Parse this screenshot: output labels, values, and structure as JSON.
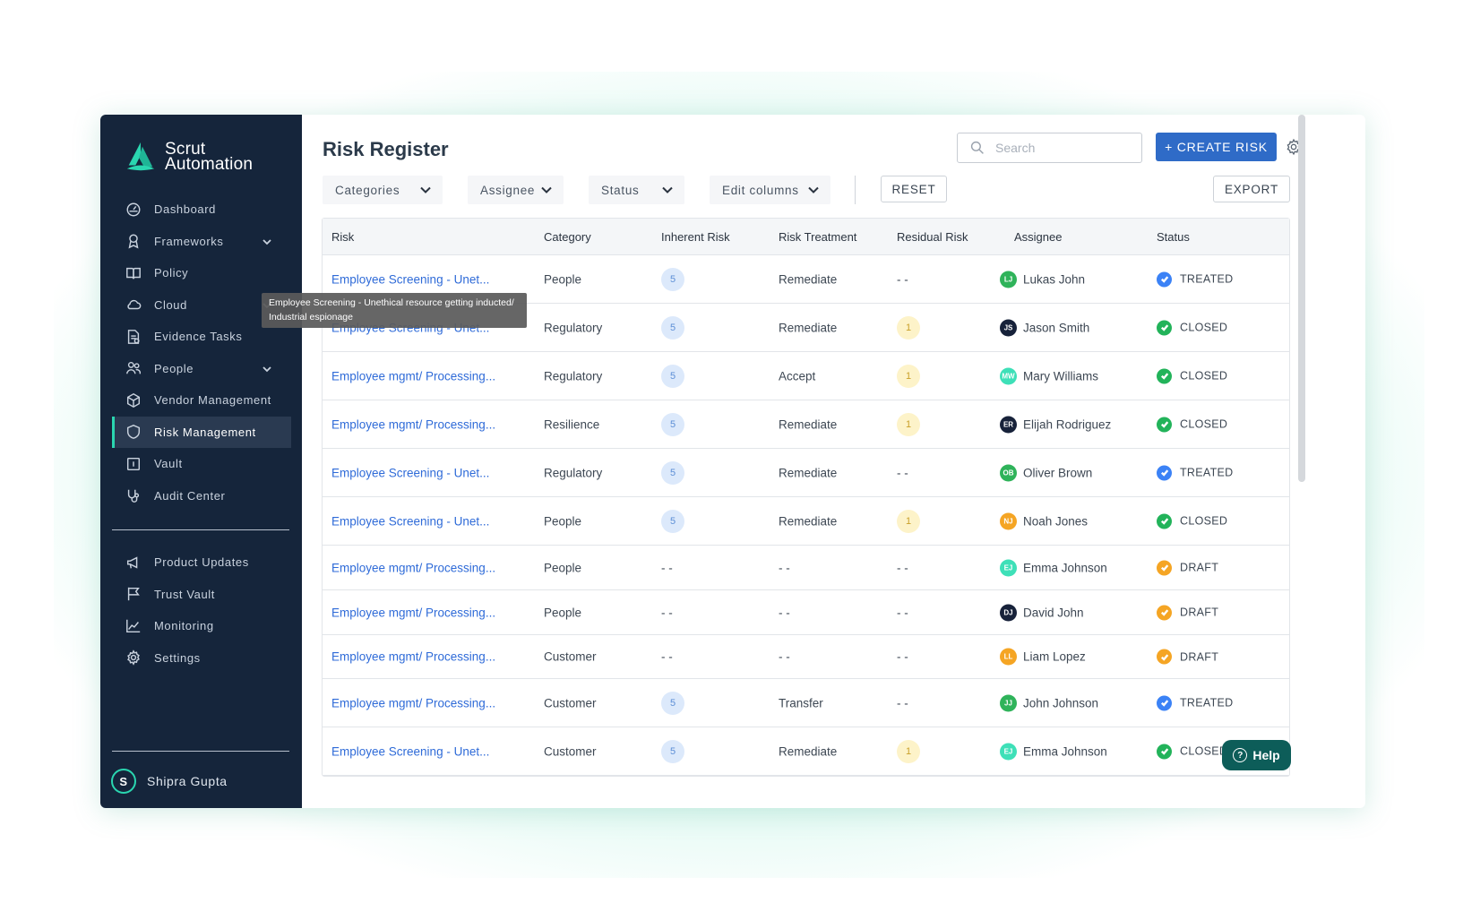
{
  "brand": {
    "line1": "Scrut",
    "line2": "Automation",
    "accent": "#2ad6b0",
    "sidebar_bg": "#15253b"
  },
  "sidebar": {
    "items": [
      {
        "label": "Dashboard",
        "icon": "dashboard-icon",
        "chevron": false
      },
      {
        "label": "Frameworks",
        "icon": "frameworks-icon",
        "chevron": true
      },
      {
        "label": "Policy",
        "icon": "policy-icon",
        "chevron": false
      },
      {
        "label": "Cloud",
        "icon": "cloud-icon",
        "chevron": true
      },
      {
        "label": "Evidence Tasks",
        "icon": "evidence-icon",
        "chevron": false
      },
      {
        "label": "People",
        "icon": "people-icon",
        "chevron": true
      },
      {
        "label": "Vendor Management",
        "icon": "vendor-icon",
        "chevron": false
      },
      {
        "label": "Risk Management",
        "icon": "shield-icon",
        "chevron": false,
        "active": true
      },
      {
        "label": "Vault",
        "icon": "vault-icon",
        "chevron": false
      },
      {
        "label": "Audit Center",
        "icon": "audit-icon",
        "chevron": false
      }
    ],
    "secondary": [
      {
        "label": "Product Updates",
        "icon": "megaphone-icon"
      },
      {
        "label": "Trust Vault",
        "icon": "flag-icon"
      },
      {
        "label": "Monitoring",
        "icon": "chart-icon"
      },
      {
        "label": "Settings",
        "icon": "gear-icon"
      }
    ],
    "user": {
      "initial": "S",
      "name": "Shipra Gupta"
    }
  },
  "header": {
    "title": "Risk Register",
    "search_placeholder": "Search",
    "create_label": "+ CREATE RISK",
    "create_color": "#2f6bc7"
  },
  "filters": {
    "categories": "Categories",
    "assignee": "Assignee",
    "status": "Status",
    "edit_columns": "Edit columns",
    "reset": "RESET",
    "export": "EXPORT"
  },
  "table": {
    "columns": [
      "Risk",
      "Category",
      "Inherent Risk",
      "Risk Treatment",
      "Residual Risk",
      "Assignee",
      "Status"
    ],
    "rows": [
      {
        "risk": "Employee Screening - Unet...",
        "category": "People",
        "inherent": "5",
        "treatment": "Remediate",
        "residual": "- -",
        "initials": "LJ",
        "assignee": "Lukas John",
        "avatar": "#2fb35a",
        "status": "TREATED"
      },
      {
        "risk": "Employee Screening - Unet...",
        "category": "Regulatory",
        "inherent": "5",
        "treatment": "Remediate",
        "residual": "1",
        "initials": "JS",
        "assignee": "Jason Smith",
        "avatar": "#17223a",
        "status": "CLOSED"
      },
      {
        "risk": "Employee mgmt/ Processing...",
        "category": "Regulatory",
        "inherent": "5",
        "treatment": "Accept",
        "residual": "1",
        "initials": "MW",
        "assignee": "Mary Williams",
        "avatar": "#3ee0b8",
        "status": "CLOSED"
      },
      {
        "risk": "Employee mgmt/ Processing...",
        "category": "Resilience",
        "inherent": "5",
        "treatment": "Remediate",
        "residual": "1",
        "initials": "ER",
        "assignee": "Elijah Rodriguez",
        "avatar": "#17223a",
        "status": "CLOSED"
      },
      {
        "risk": "Employee Screening - Unet...",
        "category": "Regulatory",
        "inherent": "5",
        "treatment": "Remediate",
        "residual": "- -",
        "initials": "OB",
        "assignee": "Oliver Brown",
        "avatar": "#2fb35a",
        "status": "TREATED"
      },
      {
        "risk": "Employee Screening - Unet...",
        "category": "People",
        "inherent": "5",
        "treatment": "Remediate",
        "residual": "1",
        "initials": "NJ",
        "assignee": "Noah Jones",
        "avatar": "#f5a524",
        "status": "CLOSED"
      },
      {
        "risk": "Employee mgmt/ Processing...",
        "category": "People",
        "inherent": "- -",
        "treatment": "- -",
        "residual": "- -",
        "initials": "EJ",
        "assignee": "Emma Johnson",
        "avatar": "#3ee0b8",
        "status": "DRAFT"
      },
      {
        "risk": "Employee mgmt/ Processing...",
        "category": "People",
        "inherent": "- -",
        "treatment": "- -",
        "residual": "- -",
        "initials": "DJ",
        "assignee": "David John",
        "avatar": "#17223a",
        "status": "DRAFT"
      },
      {
        "risk": "Employee mgmt/ Processing...",
        "category": "Customer",
        "inherent": "- -",
        "treatment": "- -",
        "residual": "- -",
        "initials": "LL",
        "assignee": "Liam Lopez",
        "avatar": "#f5a524",
        "status": "DRAFT"
      },
      {
        "risk": "Employee mgmt/ Processing...",
        "category": "Customer",
        "inherent": "5",
        "treatment": "Transfer",
        "residual": "- -",
        "initials": "JJ",
        "assignee": "John Johnson",
        "avatar": "#2fb35a",
        "status": "TREATED"
      },
      {
        "risk": "Employee Screening - Unet...",
        "category": "Customer",
        "inherent": "5",
        "treatment": "Remediate",
        "residual": "1",
        "initials": "EJ",
        "assignee": "Emma Johnson",
        "avatar": "#3ee0b8",
        "status": "CLOSED"
      }
    ]
  },
  "status_colors": {
    "TREATED": "#3b82f6",
    "CLOSED": "#22b35a",
    "DRAFT": "#f5a524"
  },
  "tooltip": {
    "text": "Employee Screening - Unethical resource getting inducted/ Industrial espionage"
  },
  "help": {
    "label": "Help"
  }
}
